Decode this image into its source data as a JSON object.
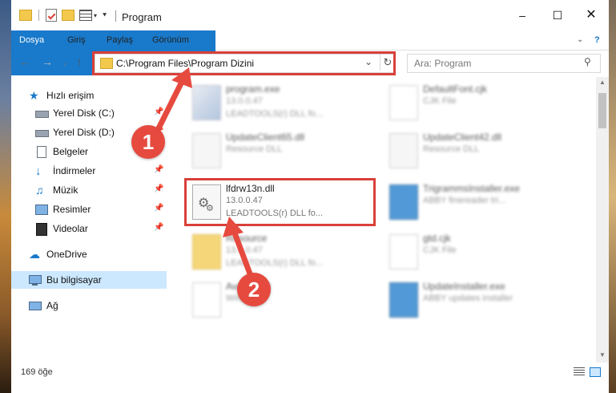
{
  "window": {
    "title": "Program"
  },
  "ribbon": {
    "tabs": [
      "Dosya",
      "Giriş",
      "Paylaş",
      "Görünüm"
    ]
  },
  "address": {
    "path": "C:\\Program Files\\Program Dizini"
  },
  "search": {
    "placeholder": "Ara: Program"
  },
  "sidebar": {
    "items": [
      {
        "label": "Hızlı erişim"
      },
      {
        "label": "Yerel Disk (C:)"
      },
      {
        "label": "Yerel Disk (D:)"
      },
      {
        "label": "Belgeler"
      },
      {
        "label": "İndirmeler"
      },
      {
        "label": "Müzik"
      },
      {
        "label": "Resimler"
      },
      {
        "label": "Videolar"
      },
      {
        "label": "OneDrive"
      },
      {
        "label": "Bu bilgisayar"
      },
      {
        "label": "Ağ"
      }
    ]
  },
  "files": [
    {
      "name": "program.exe",
      "line2": "13.0.0.47",
      "line3": "LEADTOOLS(r) DLL fo..."
    },
    {
      "name": "DefaultFont.cjk",
      "line2": "CJK File",
      "line3": ""
    },
    {
      "name": "UpdateClient65.dll",
      "line2": "Resource DLL",
      "line3": ""
    },
    {
      "name": "UpdateClient42.dll",
      "line2": "Resource DLL",
      "line3": ""
    },
    {
      "name": "lfdrw13n.dll",
      "line2": "13.0.0.47",
      "line3": "LEADTOOLS(r) DLL fo..."
    },
    {
      "name": "TrigrammsInstaller.exe",
      "line2": "ABBY finereader tri...",
      "line3": ""
    },
    {
      "name": "Resource",
      "line2": "13.0.0.47",
      "line3": "LEADTOOLS(r) DLL fo..."
    },
    {
      "name": "gtd.cjk",
      "line2": "CJK File",
      "line3": ""
    },
    {
      "name": "AvatarDlld",
      "line2": "Win...",
      "line3": ""
    },
    {
      "name": "UpdateInstaller.exe",
      "line2": "ABBY updates installer",
      "line3": ""
    }
  ],
  "status": {
    "count": "169 öğe"
  },
  "annotations": {
    "badge1": "1",
    "badge2": "2"
  },
  "colors": {
    "accent": "#1979ca",
    "highlight": "#d9403a",
    "badge": "#e64a3f",
    "selection": "#cce8ff"
  }
}
